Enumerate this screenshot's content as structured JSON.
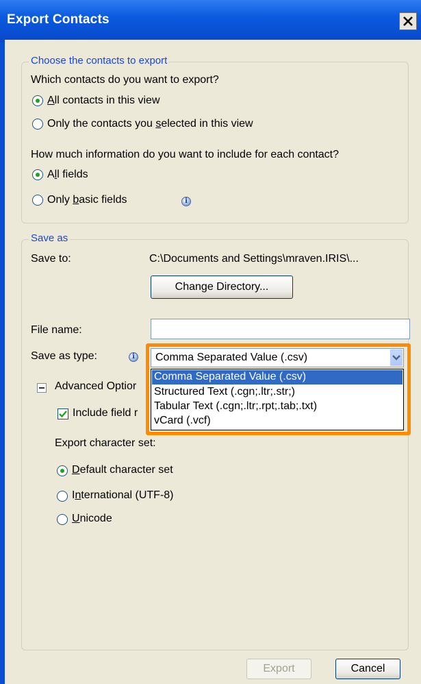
{
  "window": {
    "title": "Export Contacts"
  },
  "group_contacts": {
    "legend": "Choose the contacts to export",
    "question1": "Which contacts do you want to export?",
    "opt_all_contacts": "All contacts in this view",
    "opt_selected_contacts": "Only the contacts you selected in this view",
    "question2": "How much information do you want to include for each contact?",
    "opt_all_fields": "All fields",
    "opt_basic_fields": "Only basic fields",
    "selected_contacts": "All contacts in this view",
    "selected_fields": "All fields"
  },
  "group_save": {
    "legend": "Save as",
    "save_to_label": "Save to:",
    "save_to_path": "C:\\Documents and Settings\\mraven.IRIS\\...",
    "change_dir_button": "Change Directory...",
    "file_name_label": "File name:",
    "file_name_value": "",
    "save_type_label": "Save as type:",
    "save_type_value": "Comma Separated Value (.csv)",
    "type_options": [
      "Comma Separated Value (.csv)",
      "Structured Text (.cgn;.ltr;.str;)",
      "Tabular Text (.cgn;.ltr;.rpt;.tab;.txt)",
      "vCard (.vcf)"
    ],
    "advanced_label": "Advanced Options",
    "advanced_label_visible": "Advanced Optior",
    "include_field_label_visible": "Include field r",
    "include_field_checked": true,
    "charset_label": "Export character set:",
    "charset_default": "Default character set",
    "charset_international": "International (UTF-8)",
    "charset_unicode": "Unicode",
    "selected_charset": "Default character set"
  },
  "footer": {
    "export_button": "Export",
    "cancel_button": "Cancel"
  },
  "colors": {
    "accent": "#0a4ed1",
    "highlight": "#ff8c00",
    "selection": "#316ac5"
  }
}
